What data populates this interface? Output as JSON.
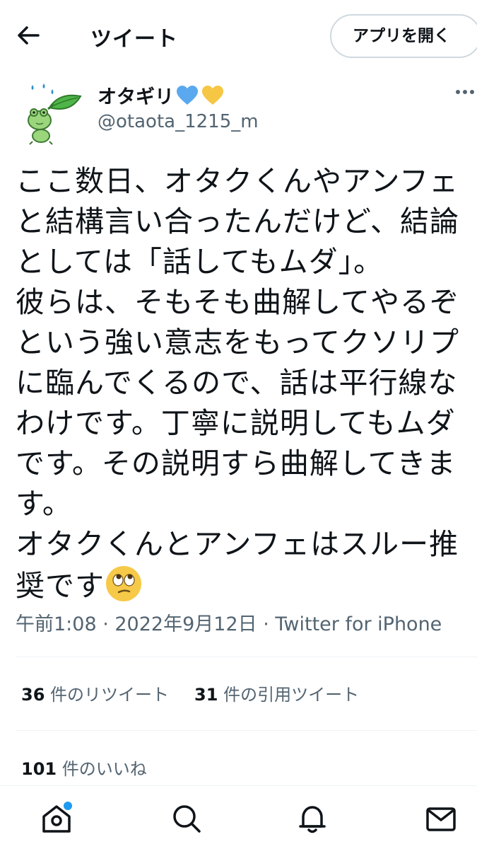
{
  "header": {
    "title": "ツイート",
    "open_app_label": "アプリを開く"
  },
  "author": {
    "name": "オタギリ",
    "handle": "@otaota_1215_m",
    "heart_colors": [
      "#5aa9ef",
      "#f6c744"
    ]
  },
  "tweet": {
    "text": "ここ数日、オタクくんやアンフェ\nと結構言い合ったんだけど、結論\nとしては「話してもムダ」。\n彼らは、そもそも曲解してやるぞ\nという強い意志をもってクソリプ\nに臨んでくるので、話は平行線な\nわけです。丁寧に説明してもムダ\nです。その説明すら曲解してきま\nす。\nオタクくんとアンフェはスルー推\n奨です",
    "emoji": "eye-roll-face",
    "meta": "午前1:08 · 2022年9月12日 · Twitter for iPhone"
  },
  "stats": {
    "retweets_count": "36",
    "retweets_label": " 件のリツイート",
    "quotes_count": "31",
    "quotes_label": " 件の引用ツイート",
    "likes_count": "101",
    "likes_label": " 件のいいね"
  },
  "colors": {
    "accent": "#1d9bf0",
    "secondary_text": "#536471",
    "divider": "#eff3f4"
  },
  "nav": {
    "items": [
      "home-icon",
      "search-icon",
      "notifications-icon",
      "messages-icon"
    ]
  }
}
